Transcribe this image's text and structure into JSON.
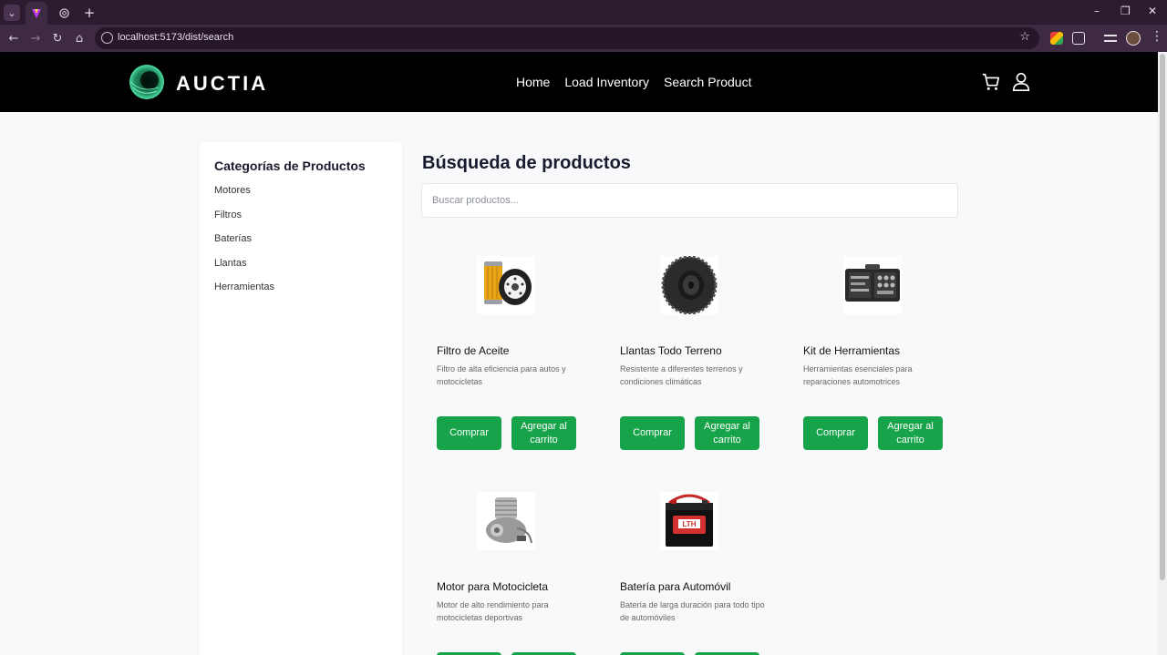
{
  "browser": {
    "url": "localhost:5173/dist/search",
    "new_tab_label": "+",
    "window_controls": [
      "–",
      "❐",
      "✕"
    ],
    "icons": [
      "tab-list-icon",
      "vite-favicon-icon",
      "globe-favicon-icon",
      "back-icon",
      "forward-icon",
      "reload-icon",
      "home-icon",
      "site-info-icon",
      "star-icon",
      "extension-icon",
      "puzzle-icon",
      "media-icon",
      "profile-icon",
      "more-icon"
    ]
  },
  "header": {
    "logo_text": "AUCTIA",
    "nav": [
      "Home",
      "Load Inventory",
      "Search Product"
    ],
    "icons": [
      "cart-icon",
      "user-icon"
    ]
  },
  "sidebar": {
    "title": "Categorías de Productos",
    "categories": [
      "Motores",
      "Filtros",
      "Baterías",
      "Llantas",
      "Herramientas"
    ]
  },
  "main": {
    "title": "Búsqueda de productos",
    "search_placeholder": "Buscar productos...",
    "buy_label": "Comprar",
    "add_to_cart_label": "Agregar al carrito",
    "products": [
      {
        "name": "Filtro de Aceite",
        "description": "Filtro de alta eficiencia para autos y motocicletas",
        "image": "oil-filter-image"
      },
      {
        "name": "Llantas Todo Terreno",
        "description": "Resistente a diferentes terrenos y condiciones climáticas",
        "image": "tire-image"
      },
      {
        "name": "Kit de Herramientas",
        "description": "Herramientas esenciales para reparaciones automotrices",
        "image": "tool-kit-image"
      },
      {
        "name": "Motor para Motocicleta",
        "description": "Motor de alto rendimiento para motocicletas deportivas",
        "image": "motorcycle-engine-image"
      },
      {
        "name": "Batería para Automóvil",
        "description": "Batería de larga duración para todo tipo de automóviles",
        "image": "car-battery-image"
      }
    ]
  },
  "colors": {
    "header_bg": "#000000",
    "button_green": "#16a34a",
    "page_bg": "#f8f9fa",
    "browser_frame": "#2c1b2f"
  }
}
